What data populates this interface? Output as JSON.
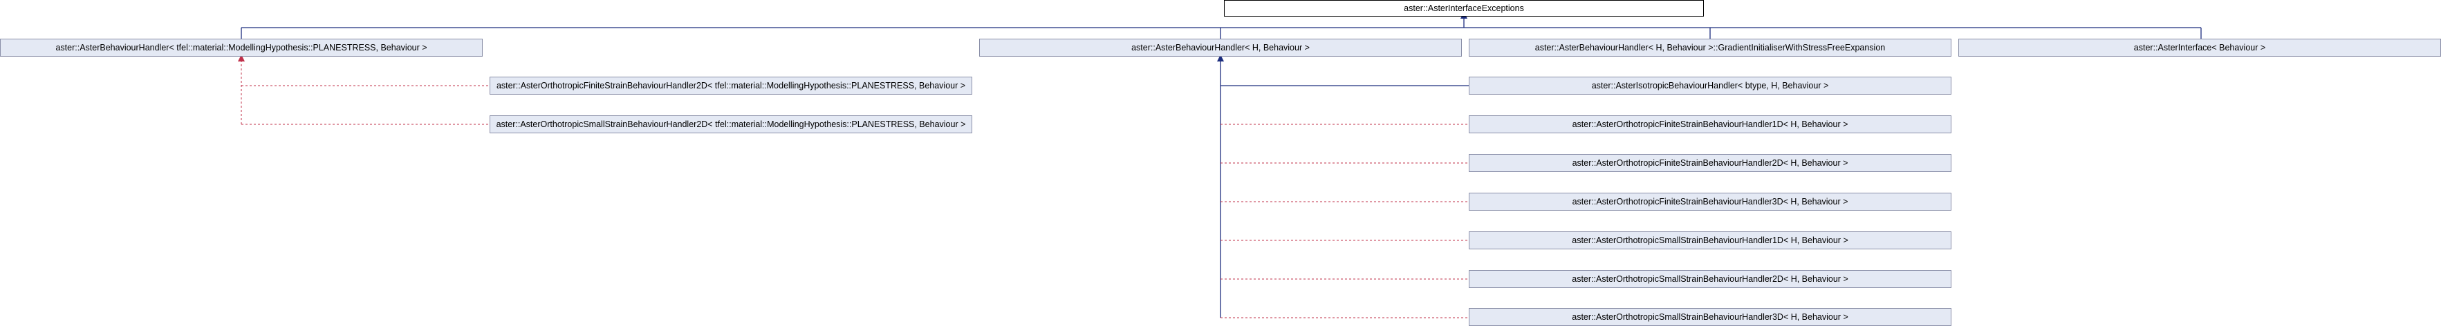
{
  "colors": {
    "public_inheritance": "#1c2d7e",
    "template_instance": "#c0304a",
    "node_fill": "#e4e9f4",
    "node_border": "#8a8fa8",
    "root_fill": "#ffffff"
  },
  "nodes": {
    "root": "aster::AsterInterfaceExceptions",
    "handler_planestress": "aster::AsterBehaviourHandler< tfel::material::ModellingHypothesis::PLANESTRESS, Behaviour >",
    "handler_generic": "aster::AsterBehaviourHandler< H, Behaviour >",
    "gradient_initialiser": "aster::AsterBehaviourHandler< H, Behaviour >::GradientInitialiserWithStressFreeExpansion",
    "aster_interface": "aster::AsterInterface< Behaviour >",
    "ortho_finite_2d_ps": "aster::AsterOrthotropicFiniteStrainBehaviourHandler2D< tfel::material::ModellingHypothesis::PLANESTRESS, Behaviour >",
    "ortho_small_2d_ps": "aster::AsterOrthotropicSmallStrainBehaviourHandler2D< tfel::material::ModellingHypothesis::PLANESTRESS, Behaviour >",
    "isotropic_handler": "aster::AsterIsotropicBehaviourHandler< btype, H, Behaviour >",
    "ortho_finite_1d": "aster::AsterOrthotropicFiniteStrainBehaviourHandler1D< H, Behaviour >",
    "ortho_finite_2d": "aster::AsterOrthotropicFiniteStrainBehaviourHandler2D< H, Behaviour >",
    "ortho_finite_3d": "aster::AsterOrthotropicFiniteStrainBehaviourHandler3D< H, Behaviour >",
    "ortho_small_1d": "aster::AsterOrthotropicSmallStrainBehaviourHandler1D< H, Behaviour >",
    "ortho_small_2d": "aster::AsterOrthotropicSmallStrainBehaviourHandler2D< H, Behaviour >",
    "ortho_small_3d": "aster::AsterOrthotropicSmallStrainBehaviourHandler3D< H, Behaviour >"
  }
}
